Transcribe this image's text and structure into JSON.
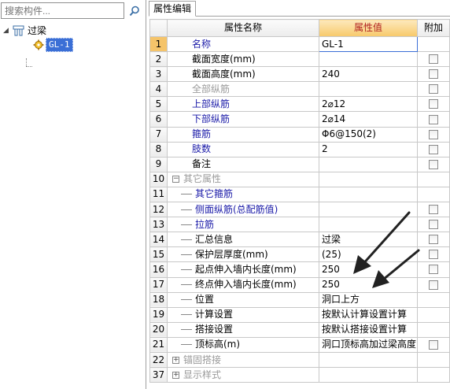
{
  "search": {
    "placeholder": "搜索构件..."
  },
  "tree": {
    "root": {
      "label": "过梁",
      "expander": "◢"
    },
    "child": {
      "label": "GL-1"
    }
  },
  "tab": {
    "label": "属性编辑"
  },
  "grid": {
    "headers": {
      "name": "属性名称",
      "value": "属性值",
      "add": "附加"
    },
    "rows": [
      {
        "num": "1",
        "name": "名称",
        "value": "GL-1",
        "color": "blue",
        "checkbox": false,
        "style": "indent",
        "selected": true
      },
      {
        "num": "2",
        "name": "截面宽度(mm)",
        "value": "",
        "color": "black",
        "checkbox": true,
        "style": "indent"
      },
      {
        "num": "3",
        "name": "截面高度(mm)",
        "value": "240",
        "color": "black",
        "checkbox": true,
        "style": "indent"
      },
      {
        "num": "4",
        "name": "全部纵筋",
        "value": "",
        "color": "gray",
        "checkbox": true,
        "style": "indent"
      },
      {
        "num": "5",
        "name": "上部纵筋",
        "value": "2⌀12",
        "color": "blue",
        "checkbox": true,
        "style": "indent"
      },
      {
        "num": "6",
        "name": "下部纵筋",
        "value": "2⌀14",
        "color": "blue",
        "checkbox": true,
        "style": "indent"
      },
      {
        "num": "7",
        "name": "箍筋",
        "value": "Φ6@150(2)",
        "color": "blue",
        "checkbox": true,
        "style": "indent"
      },
      {
        "num": "8",
        "name": "肢数",
        "value": "2",
        "color": "blue",
        "checkbox": true,
        "style": "indent"
      },
      {
        "num": "9",
        "name": "备注",
        "value": "",
        "color": "black",
        "checkbox": true,
        "style": "indent"
      },
      {
        "num": "10",
        "name": "其它属性",
        "value": "",
        "color": "gray",
        "checkbox": false,
        "style": "group",
        "box": "−"
      },
      {
        "num": "11",
        "name": "其它箍筋",
        "value": "",
        "color": "blue",
        "checkbox": false,
        "style": "sub"
      },
      {
        "num": "12",
        "name": "侧面纵筋(总配筋值)",
        "value": "",
        "color": "blue",
        "checkbox": true,
        "style": "sub"
      },
      {
        "num": "13",
        "name": "拉筋",
        "value": "",
        "color": "blue",
        "checkbox": true,
        "style": "sub"
      },
      {
        "num": "14",
        "name": "汇总信息",
        "value": "过梁",
        "color": "black",
        "checkbox": true,
        "style": "sub"
      },
      {
        "num": "15",
        "name": "保护层厚度(mm)",
        "value": "(25)",
        "color": "black",
        "checkbox": true,
        "style": "sub"
      },
      {
        "num": "16",
        "name": "起点伸入墙内长度(mm)",
        "value": "250",
        "color": "black",
        "checkbox": true,
        "style": "sub"
      },
      {
        "num": "17",
        "name": "终点伸入墙内长度(mm)",
        "value": "250",
        "color": "black",
        "checkbox": true,
        "style": "sub"
      },
      {
        "num": "18",
        "name": "位置",
        "value": "洞口上方",
        "color": "black",
        "checkbox": false,
        "style": "sub"
      },
      {
        "num": "19",
        "name": "计算设置",
        "value": "按默认计算设置计算",
        "color": "black",
        "checkbox": false,
        "style": "sub"
      },
      {
        "num": "20",
        "name": "搭接设置",
        "value": "按默认搭接设置计算",
        "color": "black",
        "checkbox": false,
        "style": "sub"
      },
      {
        "num": "21",
        "name": "顶标高(m)",
        "value": "洞口顶标高加过梁高度",
        "color": "black",
        "checkbox": true,
        "style": "sub"
      },
      {
        "num": "22",
        "name": "锚固搭接",
        "value": "",
        "color": "gray",
        "checkbox": false,
        "style": "group",
        "box": "+"
      },
      {
        "num": "37",
        "name": "显示样式",
        "value": "",
        "color": "gray",
        "checkbox": false,
        "style": "group",
        "box": "+"
      }
    ]
  },
  "colors": {
    "selection": "#3b6fd6",
    "header_value_bg": "#f7c96a",
    "blue_text": "#1a1aa8",
    "gray_text": "#9a9a9a"
  }
}
